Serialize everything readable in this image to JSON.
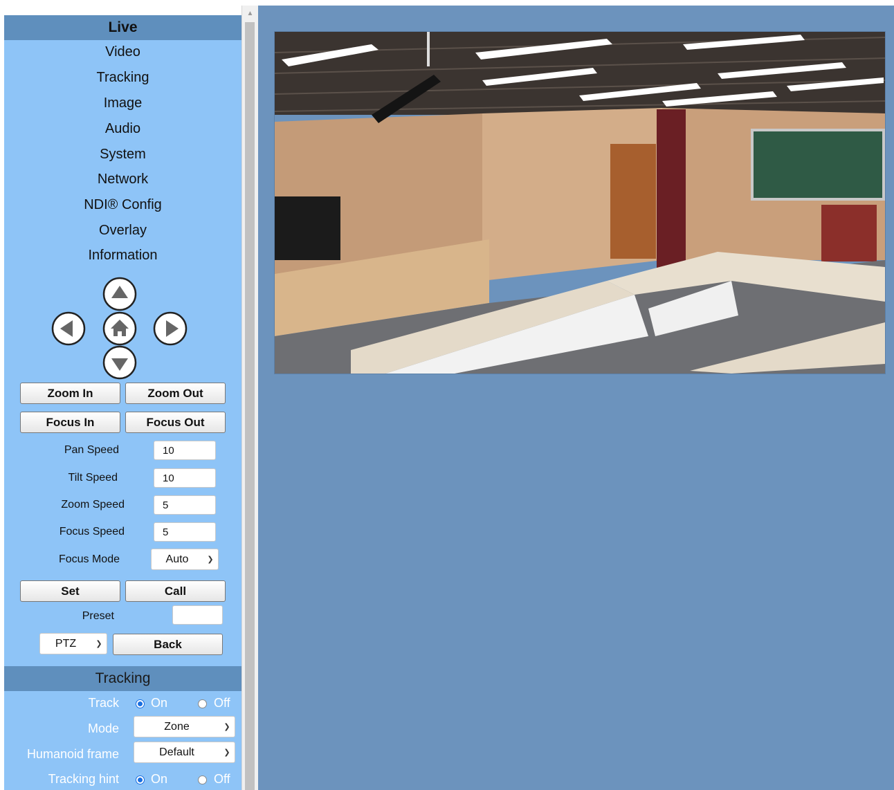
{
  "sidebar": {
    "live_header": "Live",
    "nav": [
      "Video",
      "Tracking",
      "Image",
      "Audio",
      "System",
      "Network",
      "NDI® Config",
      "Overlay",
      "Information"
    ],
    "ptz_arrows": [
      "up-arrow-icon",
      "left-arrow-icon",
      "home-icon",
      "right-arrow-icon",
      "down-arrow-icon"
    ],
    "buttons": {
      "zoom_in": "Zoom In",
      "zoom_out": "Zoom Out",
      "focus_in": "Focus In",
      "focus_out": "Focus Out",
      "set": "Set",
      "call": "Call",
      "back": "Back"
    },
    "speeds": {
      "pan_label": "Pan Speed",
      "pan_value": "10",
      "tilt_label": "Tilt Speed",
      "tilt_value": "10",
      "zoom_label": "Zoom Speed",
      "zoom_value": "5",
      "focus_label": "Focus Speed",
      "focus_value": "5"
    },
    "focus_mode": {
      "label": "Focus Mode",
      "value": "Auto"
    },
    "preset": {
      "label": "Preset",
      "value": ""
    },
    "ptz_select": {
      "value": "PTZ"
    },
    "tracking": {
      "header": "Tracking",
      "track_label": "Track",
      "mode_label": "Mode",
      "mode_value": "Zone",
      "humanoid_label": "Humanoid frame",
      "humanoid_value": "Default",
      "hint_label": "Tracking hint",
      "on": "On",
      "off": "Off",
      "track_state": "On",
      "hint_state": "On"
    }
  },
  "colors": {
    "sidebar_bg": "#8ec4f7",
    "header_bg": "#5f8fbd",
    "main_bg": "#6c93bd",
    "radio_accent": "#1a6fe0"
  }
}
